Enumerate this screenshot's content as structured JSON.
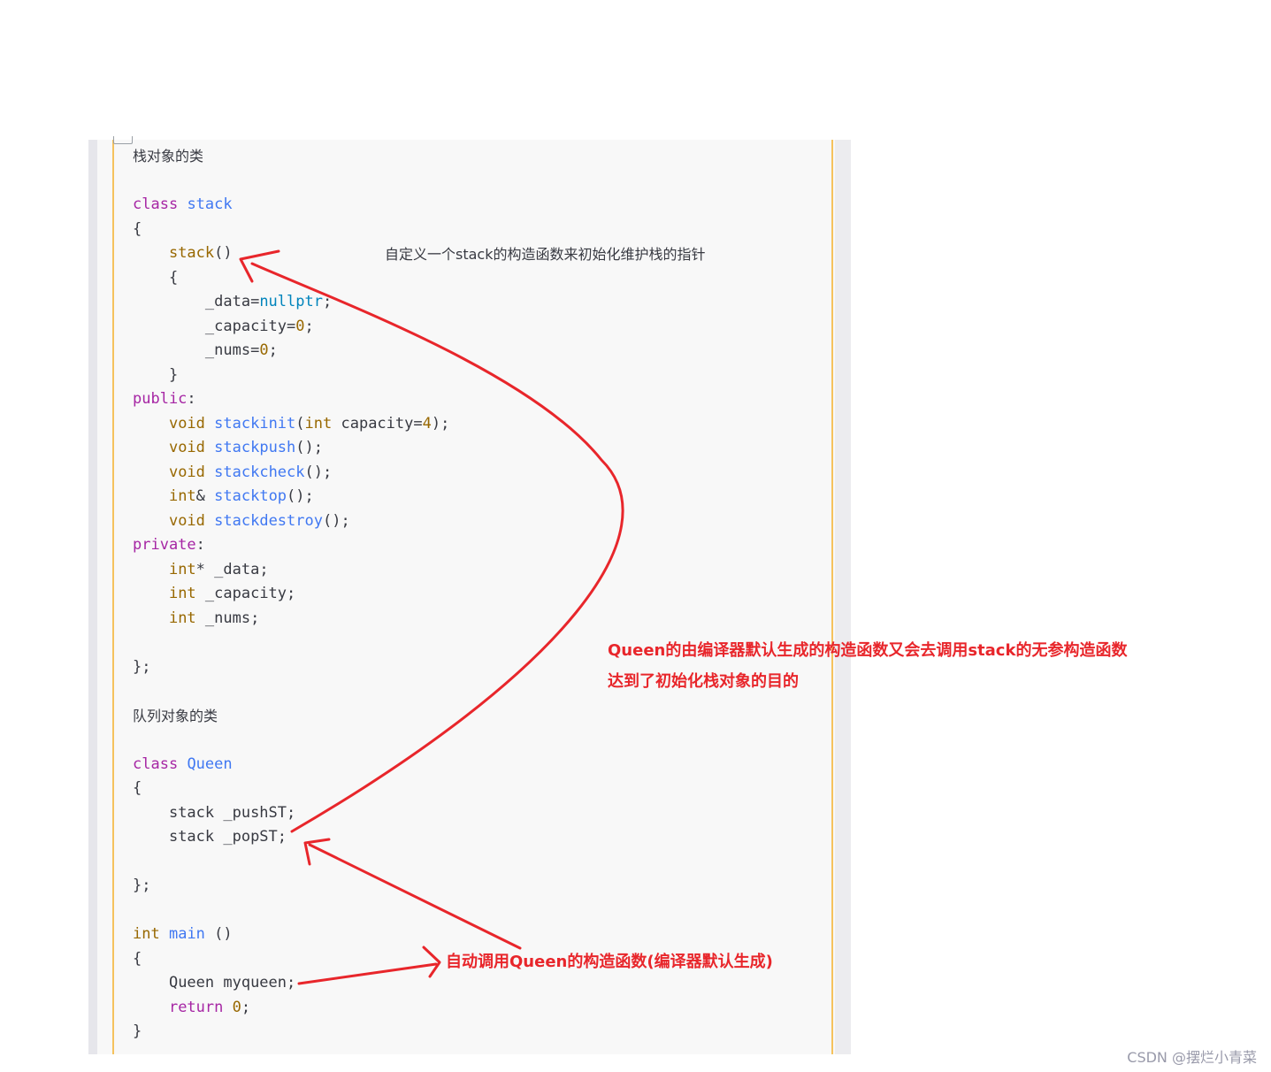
{
  "code": {
    "heading_stack": "栈对象的类",
    "heading_queue": "队列对象的类",
    "lines": {
      "l3_kw": "class",
      "l3_name": "stack",
      "open_brace": "{",
      "l5_fn": "stack",
      "l5_paren": "()",
      "l6_brace": "{",
      "l7_a": "_data=",
      "l7_b": "nullptr",
      "l7_c": ";",
      "l8_a": "_capacity=",
      "l8_b": "0",
      "l8_c": ";",
      "l9_a": "_nums=",
      "l9_b": "0",
      "l9_c": ";",
      "l10_brace": "}",
      "public_kw": "public",
      "colon": ":",
      "void": "void",
      "stackinit": "stackinit",
      "stackinit_open": "(",
      "int_kw": "int",
      "stackinit_param": " capacity=",
      "stackinit_default": "4",
      "stackinit_close": ");",
      "stackpush": "stackpush",
      "stackcheck": "stackcheck",
      "stackdestroy": "stackdestroy",
      "call_end": "();",
      "int_ref": "int",
      "amp": "& ",
      "stacktop": "stacktop",
      "private_kw": "private",
      "int_ptr": "int",
      "star_data": "* _data;",
      "cap_decl": " _capacity;",
      "nums_decl": " _nums;",
      "class_end": "};",
      "queen_name": "Queen",
      "pushst": "stack _pushST;",
      "popst": "stack _popST;",
      "main_name": "main",
      "main_paren": " ()",
      "close_brace": "}",
      "myqueen": "Queen myqueen;",
      "return_kw": "return",
      "return_val": "0",
      "semi": ";"
    }
  },
  "annotations": {
    "constructor_note": "自定义一个stack的构造函数来初始化维护栈的指针",
    "explain_line1": "Queen的由编译器默认生成的构造函数又会去调用stack的无参构造函数",
    "explain_line2": "达到了初始化栈对象的目的",
    "auto_call": "自动调用Queen的构造函数(编译器默认生成)",
    "arrow_color": "#e8262b"
  },
  "watermark": "CSDN @摆烂小青菜"
}
